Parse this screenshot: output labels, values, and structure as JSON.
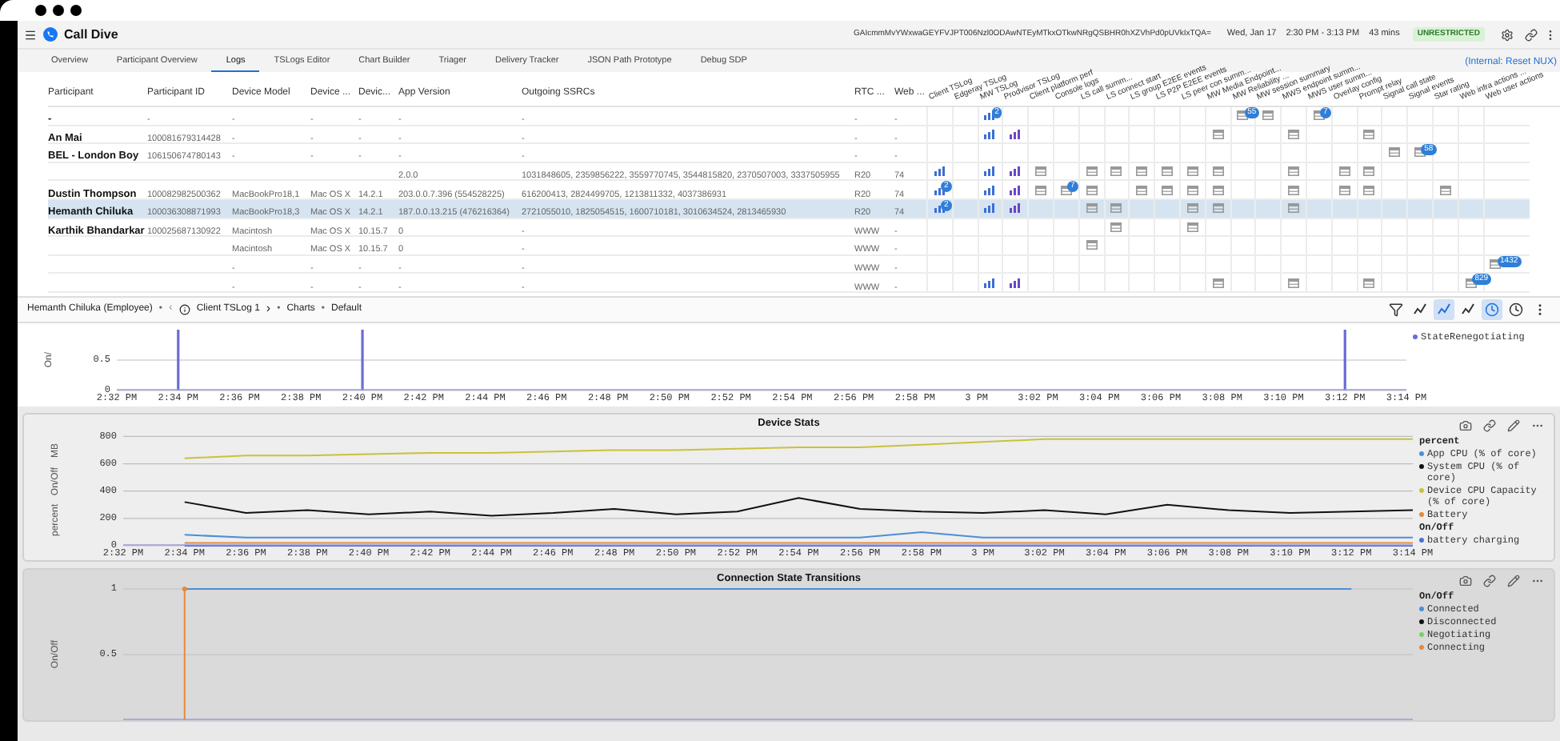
{
  "app": {
    "title": "Call Dive",
    "token": "GAIcmmMvYWxwaGEYFVJPT006Nzl0ODAwNTEyMTkxOTkwNRgQSBHR0hXZVhPd0pUVkIxTQA=",
    "date": "Wed, Jan 17",
    "time_range": "2:30 PM - 3:13 PM",
    "duration": "43 mins",
    "access_badge": "UNRESTRICTED"
  },
  "tabs": [
    {
      "label": "Overview",
      "selected": false
    },
    {
      "label": "Participant Overview",
      "selected": false
    },
    {
      "label": "Logs",
      "selected": true
    },
    {
      "label": "TSLogs Editor",
      "selected": false
    },
    {
      "label": "Chart Builder",
      "selected": false
    },
    {
      "label": "Triager",
      "selected": false
    },
    {
      "label": "Delivery Tracker",
      "selected": false
    },
    {
      "label": "JSON Path Prototype",
      "selected": false
    },
    {
      "label": "Debug SDP",
      "selected": false
    }
  ],
  "internal_link": "(Internal: Reset NUX)",
  "table": {
    "columns": [
      "Participant",
      "Participant ID",
      "Device Model",
      "Device ...",
      "Devic...",
      "App Version",
      "Outgoing SSRCs",
      "RTC ...",
      "Web ..."
    ],
    "log_columns": [
      "Client TSLog",
      "Edgeray TSLog",
      "MW TSLog",
      "Prodvisor TSLog",
      "Client platform perf",
      "Console logs",
      "LS call summ...",
      "LS connect start",
      "LS group E2EE events",
      "LS P2P E2EE events",
      "LS peer con summ...",
      "MW Media Endpoint...",
      "MW Reliability ...",
      "MW session summary",
      "MWS endpoint summ...",
      "MWS user summ...",
      "Overlay config",
      "Prompt relay",
      "Signal call state",
      "Signal events",
      "Star rating",
      "Web infra actions ...",
      "Web user actions"
    ],
    "rows": [
      {
        "selected": false,
        "cells": [
          "-",
          "-",
          "-",
          "-",
          "-",
          "-",
          "-",
          "-",
          "-"
        ],
        "logs": [
          {
            "kind": "none"
          },
          {
            "kind": "none"
          },
          {
            "kind": "chart",
            "badge": "2"
          },
          {
            "kind": "none"
          },
          {
            "kind": "none"
          },
          {
            "kind": "none"
          },
          {
            "kind": "none"
          },
          {
            "kind": "none"
          },
          {
            "kind": "none"
          },
          {
            "kind": "none"
          },
          {
            "kind": "none"
          },
          {
            "kind": "none"
          },
          {
            "kind": "doc",
            "badge": "55"
          },
          {
            "kind": "doc"
          },
          {
            "kind": "none"
          },
          {
            "kind": "doc",
            "badge": "7"
          },
          {
            "kind": "none"
          },
          {
            "kind": "none"
          },
          {
            "kind": "none"
          },
          {
            "kind": "none"
          },
          {
            "kind": "none"
          },
          {
            "kind": "none"
          },
          {
            "kind": "none"
          }
        ]
      },
      {
        "selected": false,
        "cells": [
          "An Mai",
          "100081679314428",
          "-",
          "-",
          "-",
          "-",
          "-",
          "-",
          "-"
        ],
        "logs": [
          {
            "kind": "none"
          },
          {
            "kind": "none"
          },
          {
            "kind": "chart"
          },
          {
            "kind": "trend"
          },
          {
            "kind": "none"
          },
          {
            "kind": "none"
          },
          {
            "kind": "none"
          },
          {
            "kind": "none"
          },
          {
            "kind": "none"
          },
          {
            "kind": "none"
          },
          {
            "kind": "none"
          },
          {
            "kind": "doc"
          },
          {
            "kind": "none"
          },
          {
            "kind": "none"
          },
          {
            "kind": "doc"
          },
          {
            "kind": "none"
          },
          {
            "kind": "none"
          },
          {
            "kind": "doc"
          },
          {
            "kind": "none"
          },
          {
            "kind": "none"
          },
          {
            "kind": "none"
          },
          {
            "kind": "none"
          },
          {
            "kind": "none"
          }
        ]
      },
      {
        "selected": false,
        "cells": [
          "BEL - London Boy",
          "106150674780143",
          "-",
          "-",
          "-",
          "-",
          "-",
          "-",
          "-"
        ],
        "logs": [
          {
            "kind": "none"
          },
          {
            "kind": "none"
          },
          {
            "kind": "none"
          },
          {
            "kind": "none"
          },
          {
            "kind": "none"
          },
          {
            "kind": "none"
          },
          {
            "kind": "none"
          },
          {
            "kind": "none"
          },
          {
            "kind": "none"
          },
          {
            "kind": "none"
          },
          {
            "kind": "none"
          },
          {
            "kind": "none"
          },
          {
            "kind": "none"
          },
          {
            "kind": "none"
          },
          {
            "kind": "none"
          },
          {
            "kind": "none"
          },
          {
            "kind": "none"
          },
          {
            "kind": "none"
          },
          {
            "kind": "doc"
          },
          {
            "kind": "doc",
            "badge": "58"
          },
          {
            "kind": "none"
          },
          {
            "kind": "none"
          },
          {
            "kind": "none"
          }
        ]
      },
      {
        "selected": false,
        "cells": [
          null,
          null,
          null,
          null,
          null,
          "2.0.0",
          "1031848605, 2359856222, 3559770745, 3544815820, 2370507003, 3337505955",
          "R20",
          "74"
        ],
        "logs": [
          {
            "kind": "chart"
          },
          {
            "kind": "none"
          },
          {
            "kind": "chart"
          },
          {
            "kind": "trend"
          },
          {
            "kind": "doc"
          },
          {
            "kind": "none"
          },
          {
            "kind": "doc"
          },
          {
            "kind": "doc"
          },
          {
            "kind": "doc"
          },
          {
            "kind": "doc"
          },
          {
            "kind": "doc"
          },
          {
            "kind": "doc"
          },
          {
            "kind": "none"
          },
          {
            "kind": "none"
          },
          {
            "kind": "doc"
          },
          {
            "kind": "none"
          },
          {
            "kind": "doc"
          },
          {
            "kind": "doc"
          },
          {
            "kind": "none"
          },
          {
            "kind": "none"
          },
          {
            "kind": "none"
          },
          {
            "kind": "none"
          },
          {
            "kind": "none"
          }
        ]
      },
      {
        "selected": false,
        "cells": [
          "Dustin Thompson",
          "100082982500362",
          "MacBookPro18,1",
          "Mac OS X",
          "14.2.1",
          "203.0.0.7.396 (554528225)",
          "616200413, 2824499705, 1213811332, 4037386931",
          "R20",
          "74"
        ],
        "logs": [
          {
            "kind": "chart",
            "badge": "2"
          },
          {
            "kind": "none"
          },
          {
            "kind": "chart"
          },
          {
            "kind": "trend"
          },
          {
            "kind": "doc"
          },
          {
            "kind": "doc",
            "badge": "7"
          },
          {
            "kind": "doc"
          },
          {
            "kind": "none"
          },
          {
            "kind": "doc"
          },
          {
            "kind": "doc"
          },
          {
            "kind": "doc"
          },
          {
            "kind": "doc"
          },
          {
            "kind": "none"
          },
          {
            "kind": "none"
          },
          {
            "kind": "doc"
          },
          {
            "kind": "none"
          },
          {
            "kind": "doc"
          },
          {
            "kind": "doc"
          },
          {
            "kind": "none"
          },
          {
            "kind": "none"
          },
          {
            "kind": "doc"
          },
          {
            "kind": "none"
          },
          {
            "kind": "none"
          }
        ]
      },
      {
        "selected": true,
        "cells": [
          "Hemanth Chiluka",
          "100036308871993",
          "MacBookPro18,3",
          "Mac OS X",
          "14.2.1",
          "187.0.0.13.215 (476216364)",
          "2721055010, 1825054515, 1600710181, 3010634524, 2813465930",
          "R20",
          "74"
        ],
        "logs": [
          {
            "kind": "chart",
            "badge": "2"
          },
          {
            "kind": "none"
          },
          {
            "kind": "chart"
          },
          {
            "kind": "trend"
          },
          {
            "kind": "none"
          },
          {
            "kind": "none"
          },
          {
            "kind": "doc"
          },
          {
            "kind": "doc"
          },
          {
            "kind": "none"
          },
          {
            "kind": "none"
          },
          {
            "kind": "doc"
          },
          {
            "kind": "doc"
          },
          {
            "kind": "none"
          },
          {
            "kind": "none"
          },
          {
            "kind": "doc"
          },
          {
            "kind": "none"
          },
          {
            "kind": "none"
          },
          {
            "kind": "none"
          },
          {
            "kind": "none"
          },
          {
            "kind": "none"
          },
          {
            "kind": "none"
          },
          {
            "kind": "none"
          },
          {
            "kind": "none"
          }
        ]
      },
      {
        "selected": false,
        "cells": [
          "Karthik Bhandarkar",
          "100025687130922",
          "Macintosh",
          "Mac OS X",
          "10.15.7",
          "0",
          "-",
          "WWW",
          "-"
        ],
        "logs": [
          {
            "kind": "none"
          },
          {
            "kind": "none"
          },
          {
            "kind": "none"
          },
          {
            "kind": "none"
          },
          {
            "kind": "none"
          },
          {
            "kind": "none"
          },
          {
            "kind": "none"
          },
          {
            "kind": "doc"
          },
          {
            "kind": "none"
          },
          {
            "kind": "none"
          },
          {
            "kind": "doc"
          },
          {
            "kind": "none"
          },
          {
            "kind": "none"
          },
          {
            "kind": "none"
          },
          {
            "kind": "none"
          },
          {
            "kind": "none"
          },
          {
            "kind": "none"
          },
          {
            "kind": "none"
          },
          {
            "kind": "none"
          },
          {
            "kind": "none"
          },
          {
            "kind": "none"
          },
          {
            "kind": "none"
          },
          {
            "kind": "none"
          }
        ]
      },
      {
        "selected": false,
        "cells": [
          null,
          null,
          "Macintosh",
          "Mac OS X",
          "10.15.7",
          "0",
          "-",
          "WWW",
          "-"
        ],
        "logs": [
          {
            "kind": "none"
          },
          {
            "kind": "none"
          },
          {
            "kind": "none"
          },
          {
            "kind": "none"
          },
          {
            "kind": "none"
          },
          {
            "kind": "none"
          },
          {
            "kind": "doc"
          },
          {
            "kind": "none"
          },
          {
            "kind": "none"
          },
          {
            "kind": "none"
          },
          {
            "kind": "none"
          },
          {
            "kind": "none"
          },
          {
            "kind": "none"
          },
          {
            "kind": "none"
          },
          {
            "kind": "none"
          },
          {
            "kind": "none"
          },
          {
            "kind": "none"
          },
          {
            "kind": "none"
          },
          {
            "kind": "none"
          },
          {
            "kind": "none"
          },
          {
            "kind": "none"
          },
          {
            "kind": "none"
          },
          {
            "kind": "none"
          }
        ]
      },
      {
        "selected": false,
        "cells": [
          null,
          null,
          "-",
          "-",
          "-",
          "-",
          "-",
          "WWW",
          "-"
        ],
        "logs": [
          {
            "kind": "none"
          },
          {
            "kind": "none"
          },
          {
            "kind": "none"
          },
          {
            "kind": "none"
          },
          {
            "kind": "none"
          },
          {
            "kind": "none"
          },
          {
            "kind": "none"
          },
          {
            "kind": "none"
          },
          {
            "kind": "none"
          },
          {
            "kind": "none"
          },
          {
            "kind": "none"
          },
          {
            "kind": "none"
          },
          {
            "kind": "none"
          },
          {
            "kind": "none"
          },
          {
            "kind": "none"
          },
          {
            "kind": "none"
          },
          {
            "kind": "none"
          },
          {
            "kind": "none"
          },
          {
            "kind": "none"
          },
          {
            "kind": "none"
          },
          {
            "kind": "none"
          },
          {
            "kind": "none"
          },
          {
            "kind": "doc",
            "badge": "1432"
          }
        ]
      },
      {
        "selected": false,
        "cells": [
          null,
          null,
          "-",
          "-",
          "-",
          "-",
          "-",
          "WWW",
          "-"
        ],
        "logs": [
          {
            "kind": "none"
          },
          {
            "kind": "none"
          },
          {
            "kind": "chart"
          },
          {
            "kind": "trend"
          },
          {
            "kind": "none"
          },
          {
            "kind": "none"
          },
          {
            "kind": "none"
          },
          {
            "kind": "none"
          },
          {
            "kind": "none"
          },
          {
            "kind": "none"
          },
          {
            "kind": "none"
          },
          {
            "kind": "doc"
          },
          {
            "kind": "none"
          },
          {
            "kind": "none"
          },
          {
            "kind": "doc"
          },
          {
            "kind": "none"
          },
          {
            "kind": "none"
          },
          {
            "kind": "doc"
          },
          {
            "kind": "none"
          },
          {
            "kind": "none"
          },
          {
            "kind": "none"
          },
          {
            "kind": "doc",
            "badge": "829"
          },
          {
            "kind": "none"
          }
        ]
      }
    ]
  },
  "breadcrumb": {
    "participant": "Hemanth Chiluka (Employee)",
    "sep1": "•",
    "back": "‹",
    "log": "Client TSLog 1",
    "forward": "›",
    "sep2": "•",
    "section": "Charts",
    "sep3": "•",
    "view": "Default"
  },
  "tools": [
    {
      "kind": "filter",
      "selected": false
    },
    {
      "kind": "line",
      "selected": false
    },
    {
      "kind": "line",
      "selected": true
    },
    {
      "kind": "line",
      "selected": false
    },
    {
      "kind": "clock",
      "selected": true
    },
    {
      "kind": "clock",
      "selected": false
    },
    {
      "kind": "more",
      "selected": false
    }
  ],
  "charts": [
    {
      "y_axis_labels": [
        "On/"
      ],
      "chart_data": {
        "type": "bar",
        "grid": true,
        "legend": "right",
        "categories": [
          "2:32 PM",
          "2:34 PM",
          "2:36 PM",
          "2:38 PM",
          "2:40 PM",
          "2:42 PM",
          "2:44 PM",
          "2:46 PM",
          "2:48 PM",
          "2:50 PM",
          "2:52 PM",
          "2:54 PM",
          "2:56 PM",
          "2:58 PM",
          "3 PM",
          "3:02 PM",
          "3:04 PM",
          "3:06 PM",
          "3:08 PM",
          "3:10 PM",
          "3:12 PM",
          "3:14 PM"
        ],
        "ylim": [
          0,
          1
        ],
        "yticks": [
          0,
          0.5
        ],
        "series": [
          {
            "name": "StateRenegotiating",
            "color": "#6b6bd6",
            "values": [
              0,
              1,
              0,
              0,
              1,
              0,
              0,
              0,
              0,
              0,
              0,
              0,
              0,
              0,
              0,
              0,
              0,
              0,
              0,
              0,
              1,
              0
            ]
          }
        ]
      }
    },
    {
      "title": "Device Stats",
      "y_axis_labels": [
        "percent",
        "On/Off",
        "MB"
      ],
      "legend_headings": [
        "percent",
        "On/Off"
      ],
      "chart_data": {
        "type": "line",
        "grid": true,
        "legend": "right",
        "categories": [
          "2:32 PM",
          "2:34 PM",
          "2:36 PM",
          "2:38 PM",
          "2:40 PM",
          "2:42 PM",
          "2:44 PM",
          "2:46 PM",
          "2:48 PM",
          "2:50 PM",
          "2:52 PM",
          "2:54 PM",
          "2:56 PM",
          "2:58 PM",
          "3 PM",
          "3:02 PM",
          "3:04 PM",
          "3:06 PM",
          "3:08 PM",
          "3:10 PM",
          "3:12 PM",
          "3:14 PM"
        ],
        "ylim": [
          0,
          820
        ],
        "yticks": [
          0,
          200,
          400,
          600,
          800
        ],
        "series": [
          {
            "name": "App CPU (% of core)",
            "color": "#4a8fd8",
            "values": [
              null,
              80,
              60,
              60,
              60,
              60,
              60,
              60,
              60,
              60,
              60,
              60,
              60,
              100,
              60,
              60,
              60,
              60,
              60,
              60,
              60,
              60
            ]
          },
          {
            "name": "System CPU (% of core)",
            "color": "#111111",
            "values": [
              null,
              320,
              240,
              260,
              230,
              250,
              220,
              240,
              270,
              230,
              250,
              350,
              270,
              250,
              240,
              260,
              230,
              300,
              260,
              240,
              250,
              260
            ]
          },
          {
            "name": "Device CPU Capacity (% of core)",
            "color": "#c9c23a",
            "values": [
              null,
              640,
              660,
              660,
              670,
              680,
              680,
              690,
              700,
              700,
              710,
              720,
              720,
              740,
              760,
              780,
              780,
              780,
              780,
              780,
              780,
              780
            ]
          },
          {
            "name": "Battery",
            "color": "#e8893a",
            "values": [
              null,
              20,
              20,
              20,
              20,
              20,
              20,
              20,
              20,
              20,
              20,
              20,
              20,
              20,
              20,
              20,
              20,
              20,
              20,
              20,
              20,
              20
            ]
          },
          {
            "name": "battery charging",
            "color": "#4a6fd8",
            "values": [
              null,
              0,
              0,
              0,
              0,
              0,
              0,
              0,
              0,
              0,
              0,
              0,
              0,
              0,
              0,
              0,
              0,
              0,
              0,
              0,
              0,
              0
            ]
          }
        ]
      }
    },
    {
      "title": "Connection State Transitions",
      "y_axis_labels": [
        "On/Off"
      ],
      "legend_headings": [
        "On/Off"
      ],
      "chart_data": {
        "type": "line",
        "grid": true,
        "legend": "right",
        "ylim": [
          0,
          1
        ],
        "yticks": [
          0.5,
          1
        ],
        "series": [
          {
            "name": "Connected",
            "color": "#4a8fd8",
            "values": [
              null,
              1,
              1,
              1,
              1,
              1,
              1,
              1,
              1,
              1,
              1,
              1,
              1,
              1,
              1,
              1,
              1,
              1,
              1,
              1,
              1,
              null
            ]
          },
          {
            "name": "Disconnected",
            "color": "#111111",
            "values": [
              null,
              null,
              null,
              null,
              null,
              null,
              null,
              null,
              null,
              null,
              null,
              null,
              null,
              null,
              null,
              null,
              null,
              null,
              null,
              null,
              null,
              null
            ]
          },
          {
            "name": "Negotiating",
            "color": "#7ccf6a",
            "values": [
              null,
              null,
              null,
              null,
              null,
              null,
              null,
              null,
              null,
              null,
              null,
              null,
              null,
              null,
              null,
              null,
              null,
              null,
              null,
              null,
              null,
              null
            ]
          },
          {
            "name": "Connecting",
            "marker": true,
            "color": "#e8893a",
            "values": [
              null,
              1,
              null,
              null,
              null,
              null,
              null,
              null,
              null,
              null,
              null,
              null,
              null,
              null,
              null,
              null,
              null,
              null,
              null,
              null,
              null,
              null
            ]
          }
        ]
      }
    }
  ]
}
